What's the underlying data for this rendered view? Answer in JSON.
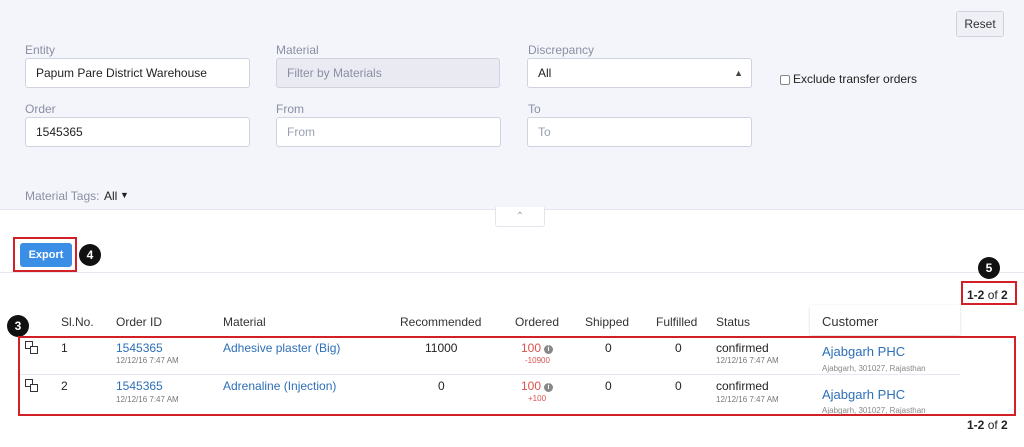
{
  "filters": {
    "reset_label": "Reset",
    "entity": {
      "label": "Entity",
      "value": "Papum Pare District Warehouse"
    },
    "material": {
      "label": "Material",
      "placeholder": "Filter by Materials"
    },
    "discrepancy": {
      "label": "Discrepancy",
      "value": "All"
    },
    "exclude_transfer": {
      "label": "Exclude transfer orders",
      "checked": false
    },
    "order": {
      "label": "Order",
      "value": "1545365"
    },
    "from": {
      "label": "From",
      "placeholder": "From"
    },
    "to": {
      "label": "To",
      "placeholder": "To"
    },
    "material_tags": {
      "label": "Material Tags:",
      "value": "All"
    }
  },
  "toolbar": {
    "export_label": "Export"
  },
  "annotations": {
    "b3": "3",
    "b4": "4",
    "b5": "5"
  },
  "pager": {
    "range": "1-2",
    "of": "of",
    "total": "2"
  },
  "table": {
    "headers": {
      "slno": "Sl.No.",
      "order_id": "Order ID",
      "material": "Material",
      "recommended": "Recommended",
      "ordered": "Ordered",
      "shipped": "Shipped",
      "fulfilled": "Fulfilled",
      "status": "Status",
      "customer": "Customer"
    },
    "rows": [
      {
        "slno": "1",
        "order_id": "1545365",
        "order_date": "12/12/16 7:47 AM",
        "material": "Adhesive plaster (Big)",
        "recommended": "11000",
        "ordered": "100",
        "ordered_diff": "-10900",
        "shipped": "0",
        "fulfilled": "0",
        "status": "confirmed",
        "status_date": "12/12/16 7:47 AM",
        "customer": "Ajabgarh PHC",
        "customer_addr": "Ajabgarh, 301027, Rajasthan"
      },
      {
        "slno": "2",
        "order_id": "1545365",
        "order_date": "12/12/16 7:47 AM",
        "material": "Adrenaline (Injection)",
        "recommended": "0",
        "ordered": "100",
        "ordered_diff": "+100",
        "shipped": "0",
        "fulfilled": "0",
        "status": "confirmed",
        "status_date": "12/12/16 7:47 AM",
        "customer": "Ajabgarh PHC",
        "customer_addr": "Ajabgarh, 301027, Rajasthan"
      }
    ]
  },
  "colors": {
    "accent": "#3a8ee6",
    "link": "#2d6fb8",
    "annotation": "#d32027",
    "ordered": "#d9534f"
  }
}
